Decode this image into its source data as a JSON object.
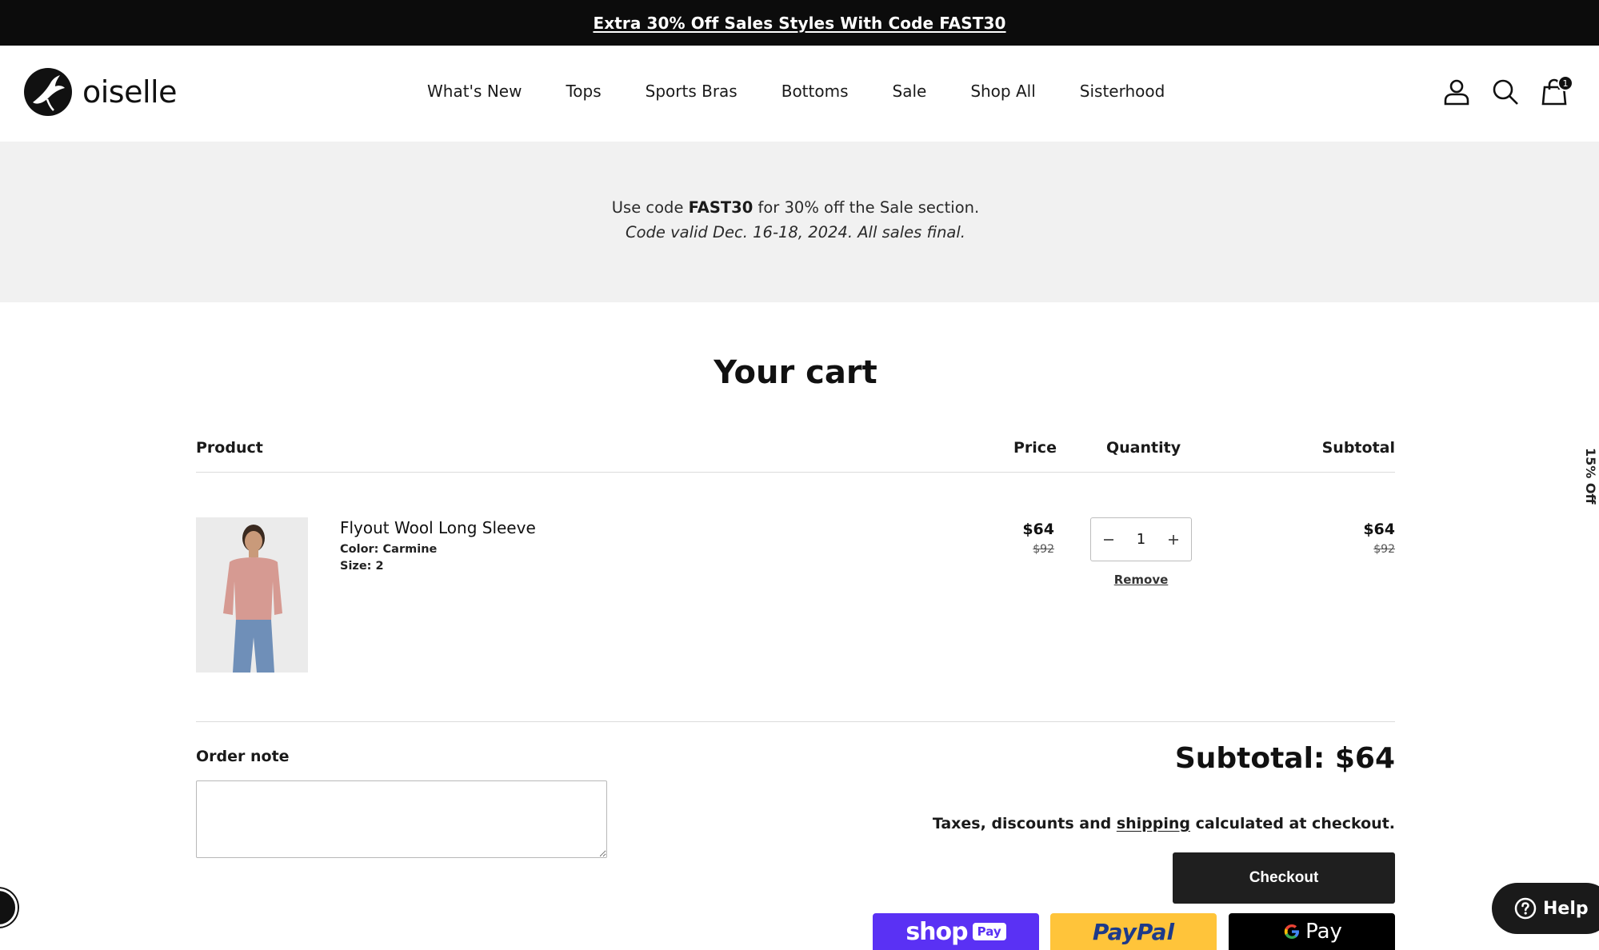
{
  "announcement": {
    "text": "Extra 30% Off Sales Styles With Code FAST30"
  },
  "header": {
    "logo_text": "oiselle",
    "nav": [
      "What's New",
      "Tops",
      "Sports Bras",
      "Bottoms",
      "Sale",
      "Shop All",
      "Sisterhood"
    ],
    "cart_count": "1",
    "icons": [
      "account-icon",
      "search-icon",
      "cart-icon"
    ]
  },
  "promo": {
    "line1_prefix": "Use code ",
    "line1_code": "FAST30",
    "line1_suffix": " for 30% off the Sale section.",
    "line2": "Code valid Dec. 16-18, 2024. All sales final."
  },
  "cart": {
    "title": "Your cart",
    "columns": {
      "product": "Product",
      "price": "Price",
      "quantity": "Quantity",
      "subtotal": "Subtotal"
    },
    "items": [
      {
        "name": "Flyout Wool Long Sleeve",
        "color": "Color: Carmine",
        "size": "Size: 2",
        "price": "$64",
        "compare_price": "$92",
        "quantity": "1",
        "line_total": "$64",
        "line_compare": "$92",
        "remove_label": "Remove"
      }
    ]
  },
  "order_note": {
    "label": "Order note",
    "value": ""
  },
  "summary": {
    "subtotal": "Subtotal: $64",
    "taxes_prefix": "Taxes, discounts and ",
    "taxes_link": "shipping",
    "taxes_suffix": " calculated at checkout.",
    "checkout_label": "Checkout"
  },
  "payment_buttons": {
    "shop_pay": {
      "text": "shop",
      "badge": "Pay",
      "color": "#5a31f4"
    },
    "paypal": {
      "text": "PayPal",
      "color": "#ffc43a"
    },
    "gpay": {
      "text": "Pay",
      "color": "#000000"
    }
  },
  "side_tab": {
    "text": "15% Off"
  },
  "help": {
    "label": "Help"
  },
  "colors": {
    "announcement_bg": "#0c0c0c",
    "promo_bg": "#f1f1f1",
    "checkout_bg": "#1f1f1f"
  }
}
